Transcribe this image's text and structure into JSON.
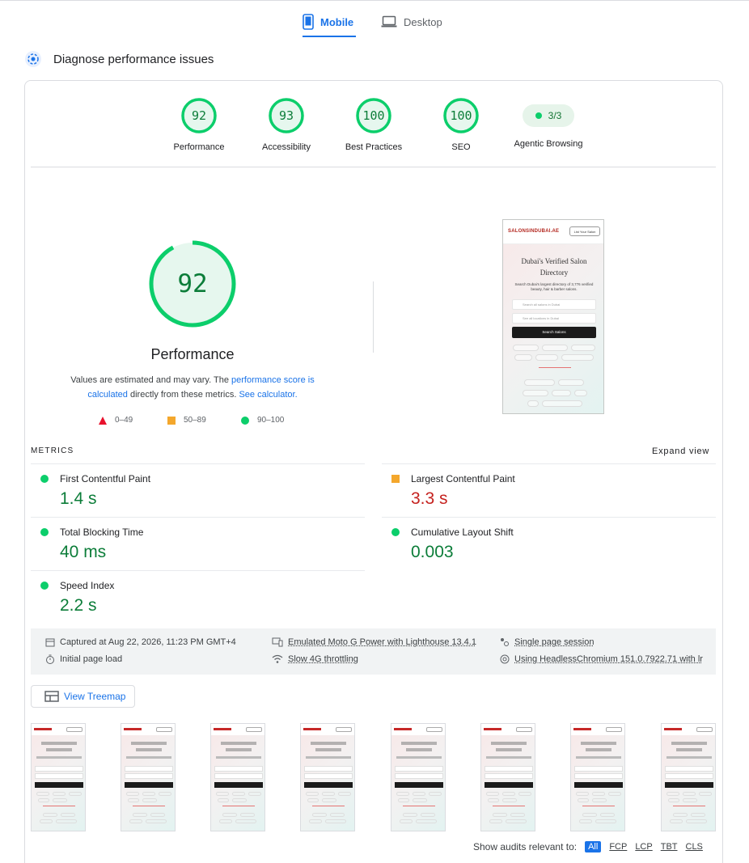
{
  "tabs": [
    {
      "label": "Mobile",
      "active": true,
      "icon": "smartphone-icon"
    },
    {
      "label": "Desktop",
      "active": false,
      "icon": "laptop-icon"
    }
  ],
  "diagnose": {
    "title": "Diagnose performance issues"
  },
  "scores": [
    {
      "value": "92",
      "label": "Performance"
    },
    {
      "value": "93",
      "label": "Accessibility"
    },
    {
      "value": "100",
      "label": "Best Practices"
    },
    {
      "value": "100",
      "label": "SEO"
    }
  ],
  "agentic": {
    "value": "3/3",
    "label": "Agentic Browsing"
  },
  "performance": {
    "score": "92",
    "title": "Performance",
    "desc_1": "Values are estimated and may vary. The ",
    "desc_link_1": "performance score is calculated",
    "desc_2": " directly from these metrics. ",
    "desc_link_2": "See calculator."
  },
  "legend": [
    {
      "label": "0–49",
      "color": "#e8112d"
    },
    {
      "label": "50–89",
      "color": "#f4a72c"
    },
    {
      "label": "90–100",
      "color": "#0cce6b"
    }
  ],
  "screenshot": {
    "logo": "SALONSINDUBAI.AE",
    "cta": "List Your Salon",
    "heading": "Dubai's Verified Salon Directory",
    "subheading": "Search Dubai's largest directory of 3,776 verified beauty, hair & barber salons.",
    "search_placeholder": "Search all salons in Dubai",
    "location_placeholder": "See all locations in Dubai",
    "search_button": "Search Salons"
  },
  "metrics": {
    "header": "METRICS",
    "expand": "Expand view",
    "items": [
      {
        "label": "First Contentful Paint",
        "value": "1.4 s",
        "status": "good"
      },
      {
        "label": "Largest Contentful Paint",
        "value": "3.3 s",
        "status": "average"
      },
      {
        "label": "Total Blocking Time",
        "value": "40 ms",
        "status": "good"
      },
      {
        "label": "Cumulative Layout Shift",
        "value": "0.003",
        "status": "good"
      },
      {
        "label": "Speed Index",
        "value": "2.2 s",
        "status": "good"
      }
    ]
  },
  "info": {
    "captured": "Captured at Aug 22, 2026, 11:23 PM GMT+4",
    "initial_load": "Initial page load",
    "device": "Emulated Moto G Power with Lighthouse 13.4.1",
    "throttling": "Slow 4G throttling",
    "session": "Single page session",
    "browser": "Using HeadlessChromium 151.0.7922.71 with lr"
  },
  "treemap": {
    "label": "View Treemap"
  },
  "filter": {
    "label": "Show audits relevant to:",
    "options": [
      "All",
      "FCP",
      "LCP",
      "TBT",
      "CLS"
    ]
  },
  "colors": {
    "accent": "#1a73e8",
    "good": "#0cce6b",
    "good_text": "#0c7d39",
    "average": "#f4a72c",
    "poor": "#e8112d"
  }
}
